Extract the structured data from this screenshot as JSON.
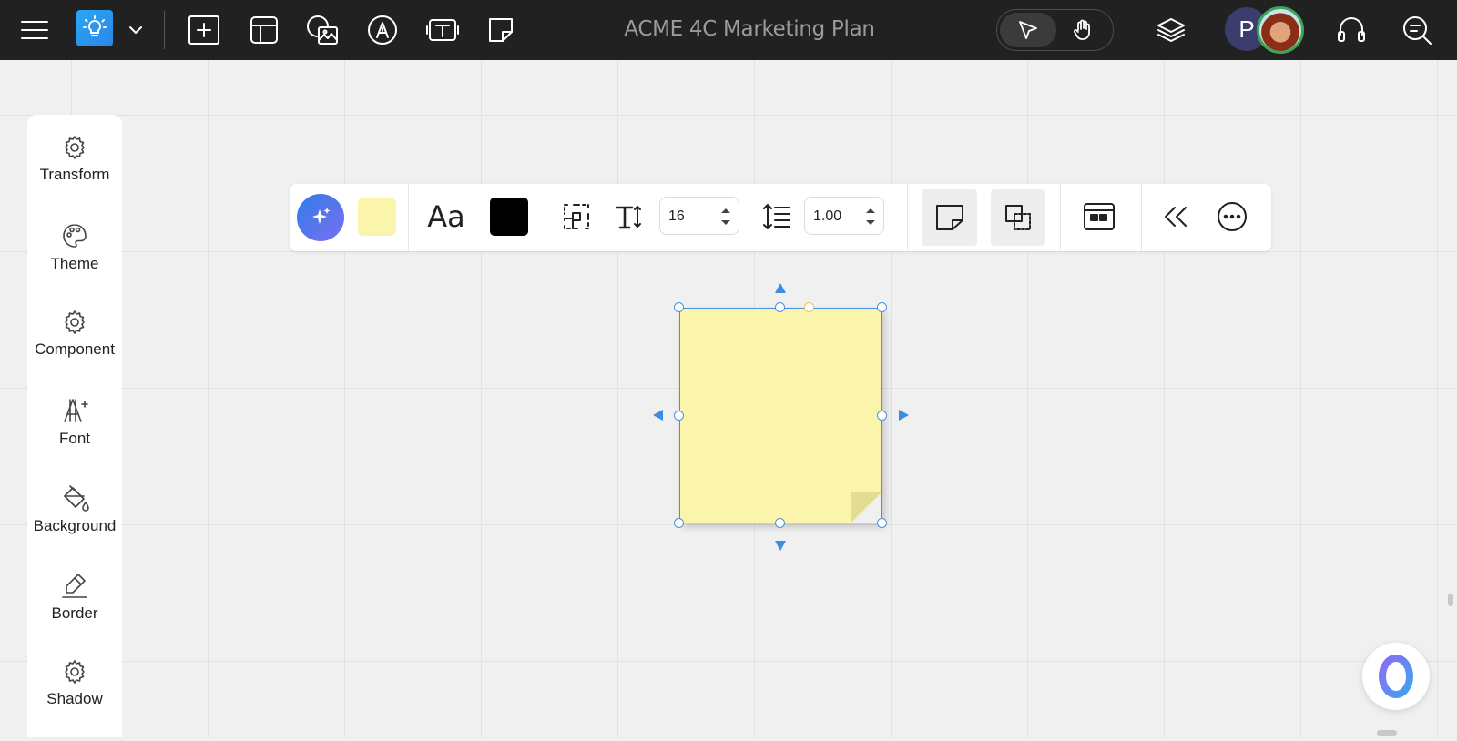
{
  "topbar": {
    "title": "ACME 4C Marketing Plan",
    "tools": [
      "menu-icon",
      "lightbulb-icon",
      "chevron-down-icon",
      "add-frame-icon",
      "layout-icon",
      "image-icon",
      "pen-icon",
      "text-box-icon",
      "sticky-note-icon"
    ],
    "modes": [
      "select",
      "pan"
    ],
    "active_mode": "select",
    "right_tools": [
      "layers-icon",
      "headset-icon",
      "search-comments-icon"
    ],
    "avatar_initial": "P"
  },
  "sidebar": {
    "items": [
      {
        "label": "Transform",
        "icon": "gear-icon"
      },
      {
        "label": "Theme",
        "icon": "palette-icon"
      },
      {
        "label": "Component",
        "icon": "gear-icon"
      },
      {
        "label": "Font",
        "icon": "font-icon"
      },
      {
        "label": "Background",
        "icon": "paint-bucket-icon"
      },
      {
        "label": "Border",
        "icon": "pen-border-icon"
      },
      {
        "label": "Shadow",
        "icon": "gear-icon"
      }
    ]
  },
  "toolbar": {
    "font_label": "Aa",
    "font_size": "16",
    "line_height": "1.00",
    "fill_color": "#fbf4ab",
    "text_color": "#000000",
    "ai_gradient": [
      "#2f7de8",
      "#7b6ff0"
    ]
  },
  "note": {
    "color": "#fbf4ab"
  },
  "colors": {
    "topbar_bg": "#212121",
    "canvas_bg": "#f0f0f0",
    "selection": "#4a90e2",
    "accent_green": "#3aa757"
  }
}
